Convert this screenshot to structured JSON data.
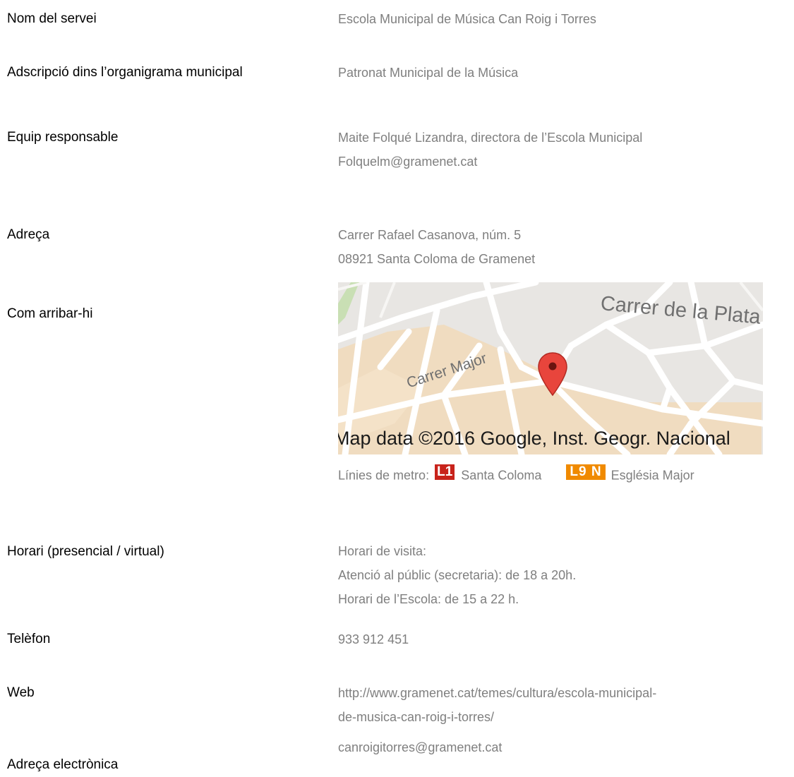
{
  "rows": {
    "nom": {
      "label": "Nom del servei",
      "value": "Escola Municipal de Música Can Roig i Torres"
    },
    "adscripcio": {
      "label": "Adscripció dins l’organigrama municipal",
      "value": "Patronat Municipal de la Música"
    },
    "equip": {
      "label": "Equip responsable",
      "line1": "Maite Folqué Lizandra, directora de l’Escola Municipal",
      "line2": "Folquelm@gramenet.cat"
    },
    "adreca": {
      "label": "Adreça",
      "line1": "Carrer Rafael Casanova, núm. 5",
      "line2": "08921 Santa Coloma de Gramenet"
    },
    "arribar": {
      "label": "Com arribar-hi",
      "map": {
        "street_plata": "Carrer de la Plata",
        "street_major": "Carrer Major",
        "copyright": "Map data ©2016 Google, Inst. Geogr. Nacional"
      },
      "metro": {
        "prefix": "Línies de metro:",
        "l1_badge": "L1",
        "l1_station": "Santa Coloma",
        "l9_badge": "L9 N",
        "l9_station": "Església Major"
      }
    },
    "horari": {
      "label": "Horari (presencial / virtual)",
      "line1": "Horari de visita:",
      "line2": "Atenció al públic (secretaria):  de 18 a 20h.",
      "line3": "Horari de l’Escola: de 15 a 22 h."
    },
    "telefon": {
      "label": "Telèfon",
      "value": "933 912 451"
    },
    "web": {
      "label": "Web",
      "line1": "http://www.gramenet.cat/temes/cultura/escola-municipal-",
      "line2": "de-musica-can-roig-i-torres/"
    },
    "email": {
      "label": "Adreça electrònica",
      "value": "canroigitorres@gramenet.cat"
    }
  },
  "colors": {
    "label": "#000000",
    "value": "#7f7f7f",
    "metro_l1": "#c8231b",
    "metro_l9": "#f08a00",
    "map_pin": "#e8453c"
  }
}
